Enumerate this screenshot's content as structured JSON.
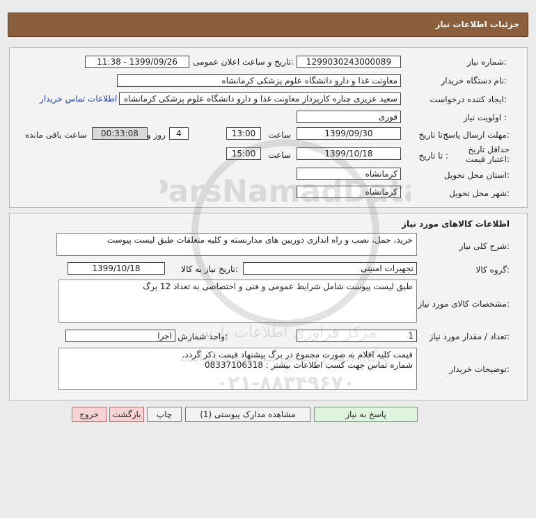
{
  "header": {
    "title": "جزئیات اطلاعات نیاز"
  },
  "info": {
    "need_number_label": "شماره نیاز:",
    "need_number": "1299030243000089",
    "announce_label": "تاریخ و ساعت اعلان عمومی:",
    "announce_value": "1399/09/26 - 11:38",
    "buyer_org_label": "نام دستگاه خریدار:",
    "buyer_org": "معاونت غذا و دارو دانشگاه علوم پزشکی کرمانشاه",
    "requester_label": "ایجاد کننده درخواست:",
    "requester": "سعید عزیزی چناره کارپرداز معاونت غذا و دارو دانشگاه علوم پزشکی کرمانشاه",
    "contact_link": "اطلاعات تماس خریدار",
    "priority_label": "اولویت نیاز :",
    "priority": "فوری",
    "deadline_label": "مهلت ارسال پاسخ:",
    "to_date_label": "تا تاریخ :",
    "deadline_date": "1399/09/30",
    "time_label": "ساعت",
    "deadline_time": "13:00",
    "days_value": "4",
    "days_label": "روز و",
    "remaining_time": "00:33:08",
    "remaining_label": "ساعت باقی مانده",
    "validity_label": "حداقل تاریخ اعتبار قیمت:",
    "validity_to_label": "تا تاریخ :",
    "validity_date": "1399/10/18",
    "validity_time_label": "ساعت",
    "validity_time": "15:00",
    "province_label": "استان محل تحویل:",
    "province": "کرمانشاه",
    "city_label": "شهر محل تحویل:",
    "city": "کرمانشاه"
  },
  "goods": {
    "section_title": "اطلاعات کالاهای مورد نیاز",
    "general_desc_label": "شرح کلی نیاز:",
    "general_desc": "خرید، حمل، نصب و راه اندازی دوربین های مداربسته و کلیه متعلقات طبق لیست پیوست",
    "group_label": "گروه کالا:",
    "group_value": "تجهیزات امنیتی",
    "need_date_label": "تاریخ نیاز به کالا:",
    "need_date": "1399/10/18",
    "specs_label": "مشخصات کالای مورد نیاز:",
    "specs": "طبق لیست پیوست شامل شرایط عمومی و فنی و اختصاصی به تعداد 12 برگ",
    "qty_label": "تعداد / مقدار مورد نیاز:",
    "qty": "1",
    "unit_label": "واحد شمارش:",
    "unit": "اجرا",
    "buyer_notes_label": "توضیحات خریدار:",
    "buyer_notes_line1": "قیمت کلیه اقلام به صورت مجموع در برگ پیشنهاد قیمت ذکر گردد.",
    "buyer_notes_line2": "شماره تماس جهت کسب اطلاعات بیشتر : 08337106318"
  },
  "buttons": {
    "respond": "پاسخ به نیاز",
    "attachments": "مشاهده مدارک پیوستی (1)",
    "print": "چاپ",
    "back": "بازگشت",
    "exit": "خروج"
  },
  "watermark": {
    "brand": "ParsNamadData",
    "line1": "مرکز فراوری اطلاعات پارس",
    "line2": "پایگاه اطلاع رسانی مناقصه و مزایده",
    "phone": "۰۲۱-۸۸۳۴۹۶۷۰"
  },
  "colors": {
    "header_bg": "#8b5e3c",
    "link": "#1a3fb4",
    "respond_bg": "#dff3df",
    "exit_bg": "#f8d4d4"
  }
}
